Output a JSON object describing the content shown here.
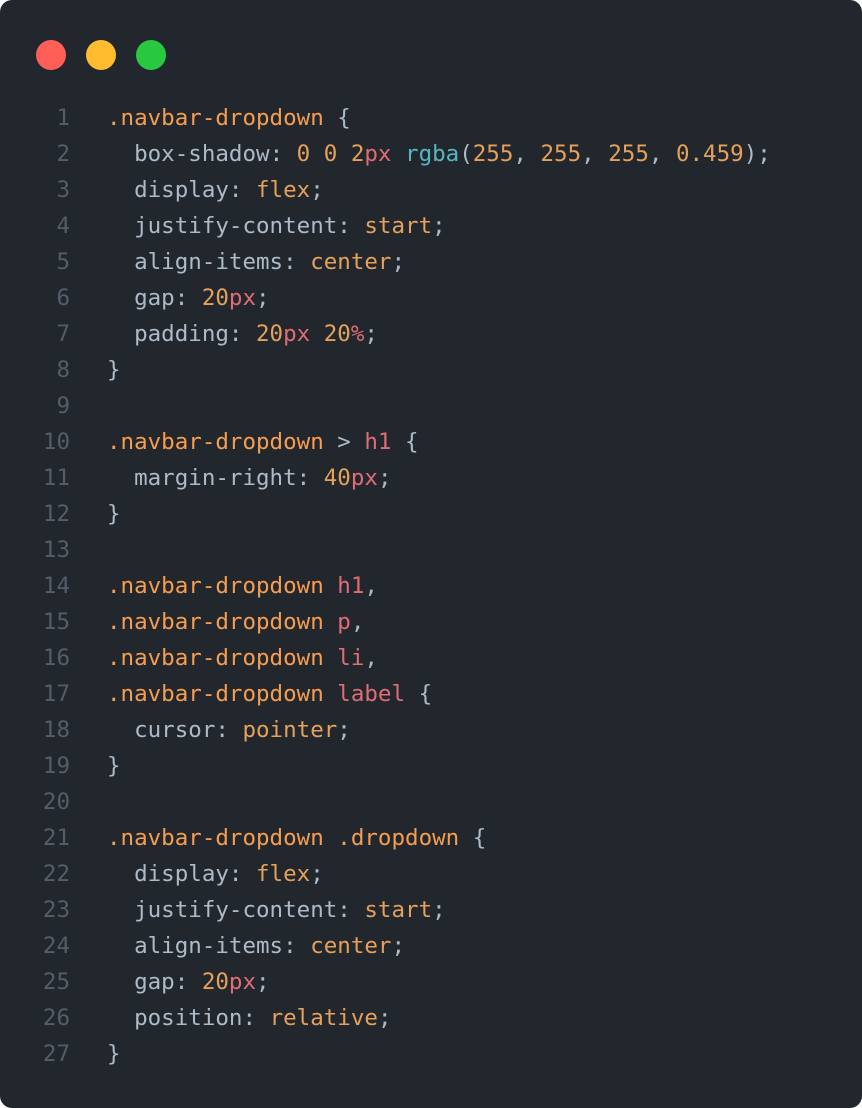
{
  "window": {
    "background": "#22272e",
    "controls": [
      {
        "name": "close",
        "color": "#ff5f57"
      },
      {
        "name": "minimize",
        "color": "#febc2e"
      },
      {
        "name": "zoom",
        "color": "#28c840"
      }
    ]
  },
  "code": {
    "language": "css",
    "lines": [
      {
        "n": "1",
        "tokens": [
          {
            "t": ".navbar-dropdown",
            "k": "selector"
          },
          {
            "t": " {",
            "k": "punct"
          }
        ]
      },
      {
        "n": "2",
        "tokens": [
          {
            "t": "  box-shadow",
            "k": "prop"
          },
          {
            "t": ": ",
            "k": "punct"
          },
          {
            "t": "0",
            "k": "number"
          },
          {
            "t": " ",
            "k": "punct"
          },
          {
            "t": "0",
            "k": "number"
          },
          {
            "t": " ",
            "k": "punct"
          },
          {
            "t": "2",
            "k": "number"
          },
          {
            "t": "px",
            "k": "unit"
          },
          {
            "t": " ",
            "k": "punct"
          },
          {
            "t": "rgba",
            "k": "func"
          },
          {
            "t": "(",
            "k": "punct"
          },
          {
            "t": "255",
            "k": "number"
          },
          {
            "t": ", ",
            "k": "punct"
          },
          {
            "t": "255",
            "k": "number"
          },
          {
            "t": ", ",
            "k": "punct"
          },
          {
            "t": "255",
            "k": "number"
          },
          {
            "t": ", ",
            "k": "punct"
          },
          {
            "t": "0.459",
            "k": "number"
          },
          {
            "t": ");",
            "k": "punct"
          }
        ]
      },
      {
        "n": "3",
        "tokens": [
          {
            "t": "  display",
            "k": "prop"
          },
          {
            "t": ": ",
            "k": "punct"
          },
          {
            "t": "flex",
            "k": "value"
          },
          {
            "t": ";",
            "k": "punct"
          }
        ]
      },
      {
        "n": "4",
        "tokens": [
          {
            "t": "  justify-content",
            "k": "prop"
          },
          {
            "t": ": ",
            "k": "punct"
          },
          {
            "t": "start",
            "k": "value"
          },
          {
            "t": ";",
            "k": "punct"
          }
        ]
      },
      {
        "n": "5",
        "tokens": [
          {
            "t": "  align-items",
            "k": "prop"
          },
          {
            "t": ": ",
            "k": "punct"
          },
          {
            "t": "center",
            "k": "value"
          },
          {
            "t": ";",
            "k": "punct"
          }
        ]
      },
      {
        "n": "6",
        "tokens": [
          {
            "t": "  gap",
            "k": "prop"
          },
          {
            "t": ": ",
            "k": "punct"
          },
          {
            "t": "20",
            "k": "number"
          },
          {
            "t": "px",
            "k": "unit"
          },
          {
            "t": ";",
            "k": "punct"
          }
        ]
      },
      {
        "n": "7",
        "tokens": [
          {
            "t": "  padding",
            "k": "prop"
          },
          {
            "t": ": ",
            "k": "punct"
          },
          {
            "t": "20",
            "k": "number"
          },
          {
            "t": "px",
            "k": "unit"
          },
          {
            "t": " ",
            "k": "punct"
          },
          {
            "t": "20",
            "k": "number"
          },
          {
            "t": "%",
            "k": "unit"
          },
          {
            "t": ";",
            "k": "punct"
          }
        ]
      },
      {
        "n": "8",
        "tokens": [
          {
            "t": "}",
            "k": "punct"
          }
        ]
      },
      {
        "n": "9",
        "tokens": []
      },
      {
        "n": "10",
        "tokens": [
          {
            "t": ".navbar-dropdown",
            "k": "selector"
          },
          {
            "t": " > ",
            "k": "punct"
          },
          {
            "t": "h1",
            "k": "tag"
          },
          {
            "t": " {",
            "k": "punct"
          }
        ]
      },
      {
        "n": "11",
        "tokens": [
          {
            "t": "  margin-right",
            "k": "prop"
          },
          {
            "t": ": ",
            "k": "punct"
          },
          {
            "t": "40",
            "k": "number"
          },
          {
            "t": "px",
            "k": "unit"
          },
          {
            "t": ";",
            "k": "punct"
          }
        ]
      },
      {
        "n": "12",
        "tokens": [
          {
            "t": "}",
            "k": "punct"
          }
        ]
      },
      {
        "n": "13",
        "tokens": []
      },
      {
        "n": "14",
        "tokens": [
          {
            "t": ".navbar-dropdown",
            "k": "selector"
          },
          {
            "t": " ",
            "k": "punct"
          },
          {
            "t": "h1",
            "k": "tag"
          },
          {
            "t": ",",
            "k": "punct"
          }
        ]
      },
      {
        "n": "15",
        "tokens": [
          {
            "t": ".navbar-dropdown",
            "k": "selector"
          },
          {
            "t": " ",
            "k": "punct"
          },
          {
            "t": "p",
            "k": "tag"
          },
          {
            "t": ",",
            "k": "punct"
          }
        ]
      },
      {
        "n": "16",
        "tokens": [
          {
            "t": ".navbar-dropdown",
            "k": "selector"
          },
          {
            "t": " ",
            "k": "punct"
          },
          {
            "t": "li",
            "k": "tag"
          },
          {
            "t": ",",
            "k": "punct"
          }
        ]
      },
      {
        "n": "17",
        "tokens": [
          {
            "t": ".navbar-dropdown",
            "k": "selector"
          },
          {
            "t": " ",
            "k": "punct"
          },
          {
            "t": "label",
            "k": "tag"
          },
          {
            "t": " {",
            "k": "punct"
          }
        ]
      },
      {
        "n": "18",
        "tokens": [
          {
            "t": "  cursor",
            "k": "prop"
          },
          {
            "t": ": ",
            "k": "punct"
          },
          {
            "t": "pointer",
            "k": "value"
          },
          {
            "t": ";",
            "k": "punct"
          }
        ]
      },
      {
        "n": "19",
        "tokens": [
          {
            "t": "}",
            "k": "punct"
          }
        ]
      },
      {
        "n": "20",
        "tokens": []
      },
      {
        "n": "21",
        "tokens": [
          {
            "t": ".navbar-dropdown",
            "k": "selector"
          },
          {
            "t": " ",
            "k": "punct"
          },
          {
            "t": ".dropdown",
            "k": "selector"
          },
          {
            "t": " {",
            "k": "punct"
          }
        ]
      },
      {
        "n": "22",
        "tokens": [
          {
            "t": "  display",
            "k": "prop"
          },
          {
            "t": ": ",
            "k": "punct"
          },
          {
            "t": "flex",
            "k": "value"
          },
          {
            "t": ";",
            "k": "punct"
          }
        ]
      },
      {
        "n": "23",
        "tokens": [
          {
            "t": "  justify-content",
            "k": "prop"
          },
          {
            "t": ": ",
            "k": "punct"
          },
          {
            "t": "start",
            "k": "value"
          },
          {
            "t": ";",
            "k": "punct"
          }
        ]
      },
      {
        "n": "24",
        "tokens": [
          {
            "t": "  align-items",
            "k": "prop"
          },
          {
            "t": ": ",
            "k": "punct"
          },
          {
            "t": "center",
            "k": "value"
          },
          {
            "t": ";",
            "k": "punct"
          }
        ]
      },
      {
        "n": "25",
        "tokens": [
          {
            "t": "  gap",
            "k": "prop"
          },
          {
            "t": ": ",
            "k": "punct"
          },
          {
            "t": "20",
            "k": "number"
          },
          {
            "t": "px",
            "k": "unit"
          },
          {
            "t": ";",
            "k": "punct"
          }
        ]
      },
      {
        "n": "26",
        "tokens": [
          {
            "t": "  position",
            "k": "prop"
          },
          {
            "t": ": ",
            "k": "punct"
          },
          {
            "t": "relative",
            "k": "value"
          },
          {
            "t": ";",
            "k": "punct"
          }
        ]
      },
      {
        "n": "27",
        "tokens": [
          {
            "t": "}",
            "k": "punct"
          }
        ]
      }
    ]
  }
}
